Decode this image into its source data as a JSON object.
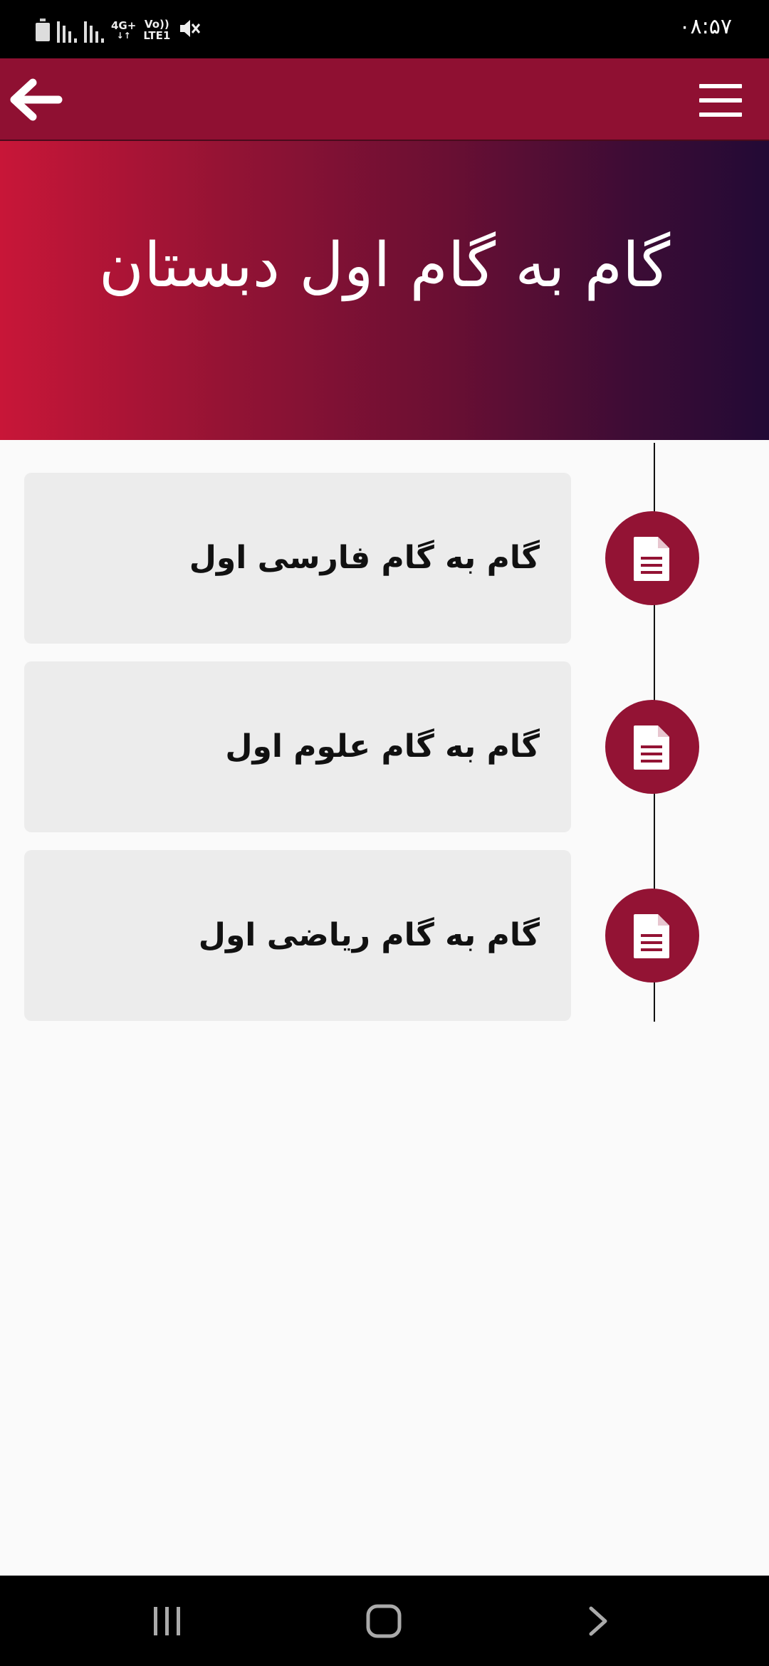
{
  "status_bar": {
    "time": "۰۸:۵۷",
    "network_primary": "4G+",
    "network_secondary": "Vo))",
    "network_tertiary": "LTE1",
    "icons": [
      "battery-icon",
      "signal-icon",
      "signal-icon",
      "mute-icon"
    ]
  },
  "app_bar": {
    "back_icon": "arrow-left-icon",
    "menu_icon": "hamburger-menu-icon",
    "color": "#8f1032"
  },
  "hero": {
    "title": "گام به گام اول دبستان"
  },
  "items": [
    {
      "label": "گام به گام فارسی اول",
      "icon": "document-icon"
    },
    {
      "label": "گام به گام علوم اول",
      "icon": "document-icon"
    },
    {
      "label": "گام به گام ریاضی اول",
      "icon": "document-icon"
    }
  ],
  "nav_bar": {
    "buttons": [
      "recents-icon",
      "home-icon",
      "back-chevron-icon"
    ]
  },
  "colors": {
    "accent": "#931334",
    "card_bg": "#ececec",
    "page_bg": "#fafafa"
  }
}
